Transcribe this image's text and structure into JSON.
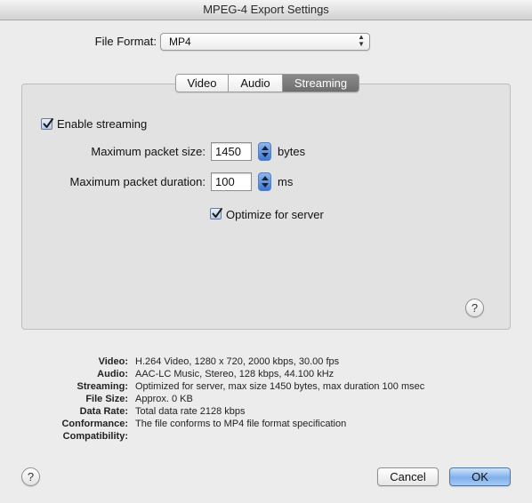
{
  "window": {
    "title": "MPEG-4 Export Settings"
  },
  "file_format": {
    "label": "File Format:",
    "value": "MP4"
  },
  "tabs": [
    {
      "label": "Video",
      "active": false
    },
    {
      "label": "Audio",
      "active": false
    },
    {
      "label": "Streaming",
      "active": true
    }
  ],
  "streaming": {
    "enable_label": "Enable streaming",
    "enable_checked": true,
    "packet_size_label": "Maximum packet size:",
    "packet_size_value": "1450",
    "packet_size_unit": "bytes",
    "packet_duration_label": "Maximum packet duration:",
    "packet_duration_value": "100",
    "packet_duration_unit": "ms",
    "optimize_label": "Optimize for server",
    "optimize_checked": true
  },
  "help_glyph": "?",
  "summary": [
    {
      "label": "Video:",
      "value": "H.264 Video, 1280 x 720, 2000 kbps, 30.00 fps"
    },
    {
      "label": "Audio:",
      "value": "AAC-LC Music, Stereo, 128 kbps, 44.100 kHz"
    },
    {
      "label": "Streaming:",
      "value": "Optimized for server, max size 1450 bytes, max duration 100 msec"
    },
    {
      "label": "File Size:",
      "value": "Approx. 0 KB"
    },
    {
      "label": "Data Rate:",
      "value": "Total data rate 2128 kbps"
    },
    {
      "label": "Conformance:",
      "value": "The file conforms to MP4 file format specification"
    },
    {
      "label": "Compatibility:",
      "value": ""
    }
  ],
  "buttons": {
    "cancel": "Cancel",
    "ok": "OK"
  },
  "colors": {
    "accent": "#3e78d3",
    "active_tab": "#7a7a7a",
    "default_button": "#7fb0ec"
  }
}
